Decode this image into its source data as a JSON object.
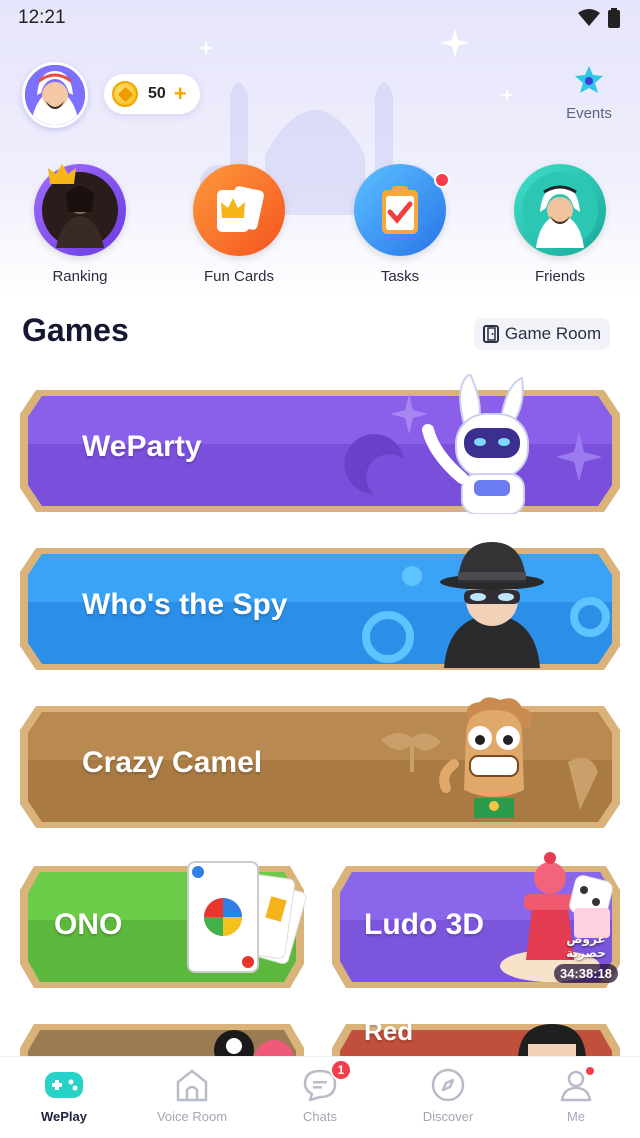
{
  "status_bar": {
    "time": "12:21"
  },
  "header": {
    "coins": "50",
    "coin_plus": "+",
    "events_label": "Events"
  },
  "shortcuts": [
    {
      "label": "Ranking"
    },
    {
      "label": "Fun Cards"
    },
    {
      "label": "Tasks"
    },
    {
      "label": "Friends"
    }
  ],
  "games": {
    "title": "Games",
    "game_room_label": "Game Room",
    "cards": [
      {
        "title": "WeParty"
      },
      {
        "title": "Who's the Spy"
      },
      {
        "title": "Crazy Camel"
      },
      {
        "title": "ONO"
      },
      {
        "title": "Ludo 3D"
      },
      {
        "title": "Red"
      }
    ],
    "ludo_promo_text": "عروض حصرية",
    "ludo_timer": "34:38:18"
  },
  "tabbar": {
    "tabs": [
      {
        "label": "WePlay"
      },
      {
        "label": "Voice Room"
      },
      {
        "label": "Chats"
      },
      {
        "label": "Discover"
      },
      {
        "label": "Me"
      }
    ],
    "chats_badge": "1"
  }
}
